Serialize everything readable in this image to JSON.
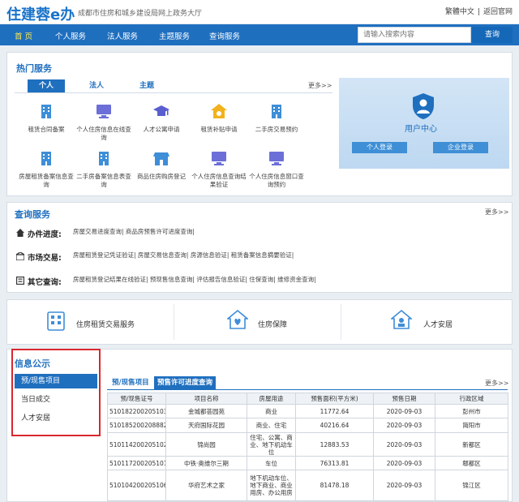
{
  "header": {
    "logo": "住建蓉e办",
    "subtitle": "成都市住房和城乡建设局网上政务大厅",
    "links": [
      "繁體中文",
      "|",
      "返回官网"
    ]
  },
  "nav": {
    "items": [
      "首  页",
      "个人服务",
      "法人服务",
      "主题服务",
      "查询服务"
    ],
    "active_index": 0,
    "search_placeholder": "请输入搜索内容",
    "search_button": "查询"
  },
  "hot": {
    "title": "热门服务",
    "tabs": [
      "个人",
      "法人",
      "主题"
    ],
    "active_tab": 0,
    "more": "更多>>",
    "services": [
      {
        "label": "租赁合同备案",
        "icon": "building-icon"
      },
      {
        "label": "个人住房信息在线查询",
        "icon": "monitor-icon"
      },
      {
        "label": "人才公寓申请",
        "icon": "graduation-cap-icon"
      },
      {
        "label": "租赁补贴申请",
        "icon": "house-subsidy-icon"
      },
      {
        "label": "二手房交易预约",
        "icon": "building-icon"
      },
      {
        "label": "房屋租赁备案信息查询",
        "icon": "building-icon"
      },
      {
        "label": "二手房备案信息表查询",
        "icon": "building-icon"
      },
      {
        "label": "商品住房购房登记",
        "icon": "shop-icon"
      },
      {
        "label": "个人住房信息查询结果验证",
        "icon": "monitor-icon"
      },
      {
        "label": "个人住房信息窗口查询预约",
        "icon": "monitor-icon"
      }
    ],
    "user_center": {
      "title": "用户中心",
      "personal_login": "个人登录",
      "enterprise_login": "企业登录"
    }
  },
  "query": {
    "title": "查询服务",
    "more": "更多>>",
    "rows": [
      {
        "label": "办件进度:",
        "links": "房屋交易进度查询| 商品房预售许可进度查询|"
      },
      {
        "label": "市场交易:",
        "links": "房屋租赁登记凭证验证| 房屋交易信息查询| 房源信息验证| 租赁备案信息摘要验证|"
      },
      {
        "label": "其它查询:",
        "links": "房屋租赁登记结果在线验证| 预现售信息查询| 评估报告信息验证| 住保查询| 维修资金查询|"
      }
    ]
  },
  "big_services": [
    {
      "label": "住房租赁交易服务"
    },
    {
      "label": "住房保障"
    },
    {
      "label": "人才安居"
    }
  ],
  "info": {
    "title": "信息公示",
    "side_items": [
      "预/现售项目",
      "当日成交",
      "人才安居"
    ],
    "active_side": 0,
    "sub_tabs": [
      "预/现售项目",
      "预售许可进度查询"
    ],
    "more": "更多>>",
    "table": {
      "headers": [
        "预/现售证号",
        "项目名称",
        "房屋用途",
        "预售面积(平方米)",
        "预售日期",
        "行政区域"
      ],
      "rows": [
        [
          "510182200205103",
          "金城都荟园苑",
          "商业",
          "11772.64",
          "2020-09-03",
          "彭州市"
        ],
        [
          "510185200208882",
          "天府国际花园",
          "商业、住宅",
          "40216.64",
          "2020-09-03",
          "简阳市"
        ],
        [
          "510114200205102",
          "锦尚园",
          "住宅、公寓、商业、地下机动车位",
          "12883.53",
          "2020-09-03",
          "新都区"
        ],
        [
          "510117200205101",
          "中铁·奥维尔三期",
          "车位",
          "76313.81",
          "2020-09-03",
          "郫都区"
        ],
        [
          "510104200205106",
          "华府艺术之家",
          "地下机动车位、地下商业、商业用房、办公用房",
          "81478.18",
          "2020-09-03",
          "锦江区"
        ]
      ]
    }
  }
}
